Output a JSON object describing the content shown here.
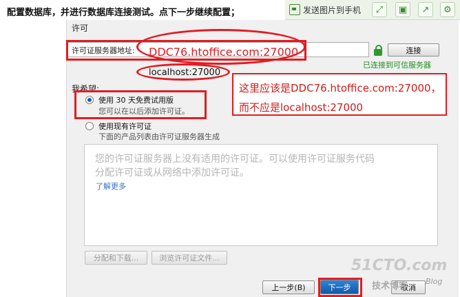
{
  "caption": "配置数据库，并进行数据库连接测试。点下一步继续配置；",
  "toolbar": {
    "send_label": "发送图片到手机",
    "buttons": [
      "expand-icon",
      "save-icon",
      "share-icon",
      "settings-icon"
    ]
  },
  "license": {
    "section_title": "许可",
    "server_label": "许可证服务器地址:",
    "server_value": "DDC76.htoffice.com:27000",
    "suggestion": "localhost:27000",
    "connect_label": "连接",
    "connected_status": "已连接到可信服务器"
  },
  "choice": {
    "heading": "我希望:",
    "trial_title": "使用 30 天免费试用版",
    "trial_sub": "您可以在以后添加许可证。",
    "existing_title": "使用现有许可证",
    "existing_sub": "下面的产品列表由许可证服务器生成"
  },
  "license_box": {
    "text_line1": "您的许可证服务器上没有适用的许可证。可以使用许可证服务代码",
    "text_line2": "分配许可证或从网络中添加许可证。",
    "learn_more": "了解更多"
  },
  "buttons": {
    "assign": "分配和下载...",
    "browse": "浏览许可证文件...",
    "back": "上一步(B)",
    "next": "下一步",
    "cancel": "取消"
  },
  "annotation_note": {
    "line1": "这里应该是DDC76.htoffice.com:27000，",
    "line2": "而不应是localhost:27000"
  },
  "watermark": {
    "big": "51CTO.com",
    "small": "技术博客",
    "blog": "Blog"
  },
  "colors": {
    "annotation_red": "#e21b22",
    "connected_green": "#1f8f1f",
    "next_blue": "#1565b8"
  }
}
